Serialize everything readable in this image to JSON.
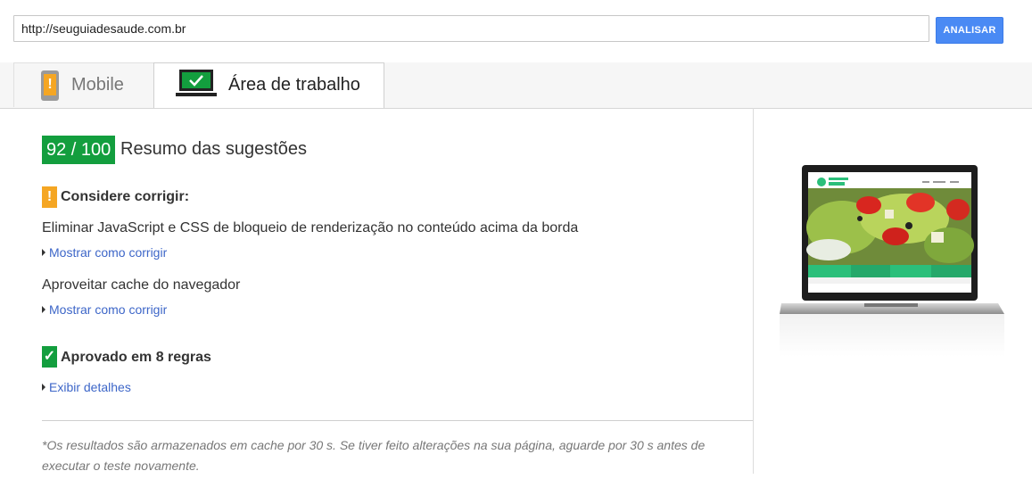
{
  "search": {
    "url_value": "http://seuguiadesaude.com.br",
    "analyze_label": "ANALISAR"
  },
  "tabs": [
    {
      "label": "Mobile",
      "icon": "phone-warning-icon",
      "selected": false
    },
    {
      "label": "Área de trabalho",
      "icon": "laptop-check-icon",
      "selected": true
    }
  ],
  "summary": {
    "score": "92 / 100",
    "title": "Resumo das sugestões"
  },
  "consider": {
    "icon": "!",
    "title": "Considere corrigir:",
    "rules": [
      {
        "title": "Eliminar JavaScript e CSS de bloqueio de renderização no conteúdo acima da borda",
        "link": "Mostrar como corrigir"
      },
      {
        "title": "Aproveitar cache do navegador",
        "link": "Mostrar como corrigir"
      }
    ]
  },
  "passed": {
    "icon": "✓",
    "title": "Aprovado em 8 regras",
    "link": "Exibir detalhes"
  },
  "footnote": "*Os resultados são armazenados em cache por 30 s. Se tiver feito alterações na sua página, aguarde por 30 s antes de executar o teste novamente.",
  "colors": {
    "accent_blue": "#4a8af4",
    "pass_green": "#139e3e",
    "warn_orange": "#f5a623",
    "link_blue": "#3d66c8"
  }
}
